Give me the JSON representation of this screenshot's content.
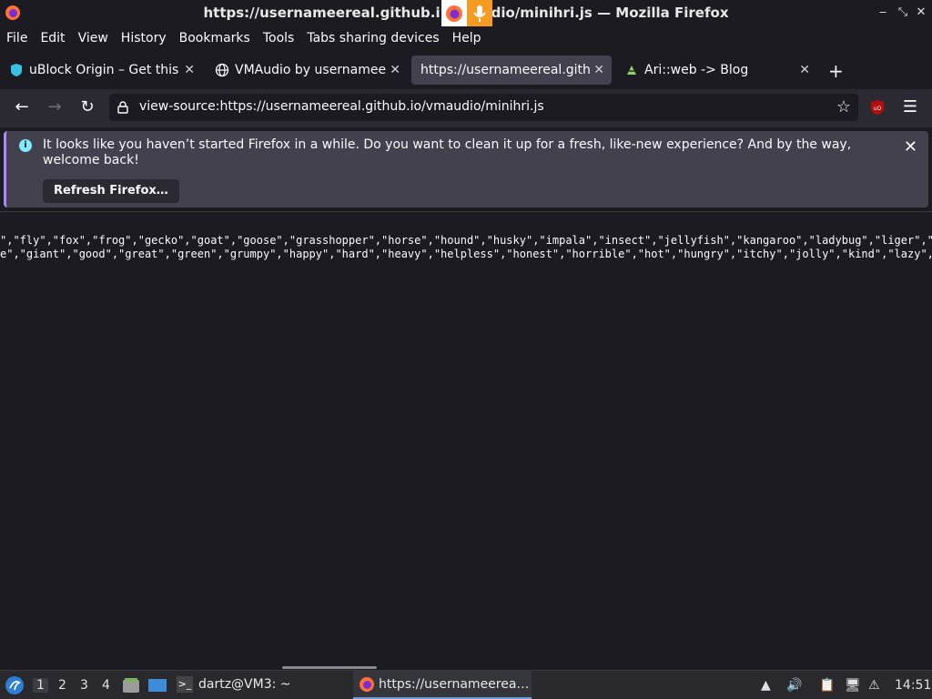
{
  "window": {
    "title": "https://usernameereal.github.io/vmaudio/minihri.js — Mozilla Firefox",
    "title_visible_left": "https://usernameereal.github.i",
    "title_visible_right": "dio/minihri.js — Mozilla Firefox"
  },
  "menu": [
    "File",
    "Edit",
    "View",
    "History",
    "Bookmarks",
    "Tools",
    "Tabs sharing devices",
    "Help"
  ],
  "tabs": [
    {
      "label": "uBlock Origin – Get this E",
      "icon": "ublock-icon",
      "active": false
    },
    {
      "label": "VMAudio by usernamee",
      "icon": "globe-icon",
      "active": false
    },
    {
      "label": "https://usernameereal.githu",
      "icon": "",
      "active": true
    },
    {
      "label": "Ari::web -> Blog",
      "icon": "blog-icon",
      "active": false
    }
  ],
  "navbar": {
    "url": "view-source:https://usernameereal.github.io/vmaudio/minihri.js"
  },
  "notification": {
    "text": "It looks like you haven’t started Firefox in a while. Do you want to clean it up for a fresh, like-new experience? And by the way, welcome back!",
    "button": "Refresh Firefox…"
  },
  "source": {
    "line1": "\",\"fly\",\"fox\",\"frog\",\"gecko\",\"goat\",\"goose\",\"grasshopper\",\"horse\",\"hound\",\"husky\",\"impala\",\"insect\",\"jellyfish\",\"kangaroo\",\"ladybug\",\"liger\",\"l",
    "line2": "e\",\"giant\",\"good\",\"great\",\"green\",\"grumpy\",\"happy\",\"hard\",\"heavy\",\"helpless\",\"honest\",\"horrible\",\"hot\",\"hungry\",\"itchy\",\"jolly\",\"kind\",\"lazy\",\"l"
  },
  "taskbar": {
    "workspaces": [
      "1",
      "2",
      "3",
      "4"
    ],
    "terminal_label": "dartz@VM3: ~",
    "firefox_label": "https://usernameerea…",
    "clock": "14:51"
  },
  "colors": {
    "background": "#1c1b22",
    "toolbar": "#2b2a33",
    "active_tab": "#42414d",
    "info": "#80ebff",
    "accent": "#a78bfa"
  }
}
